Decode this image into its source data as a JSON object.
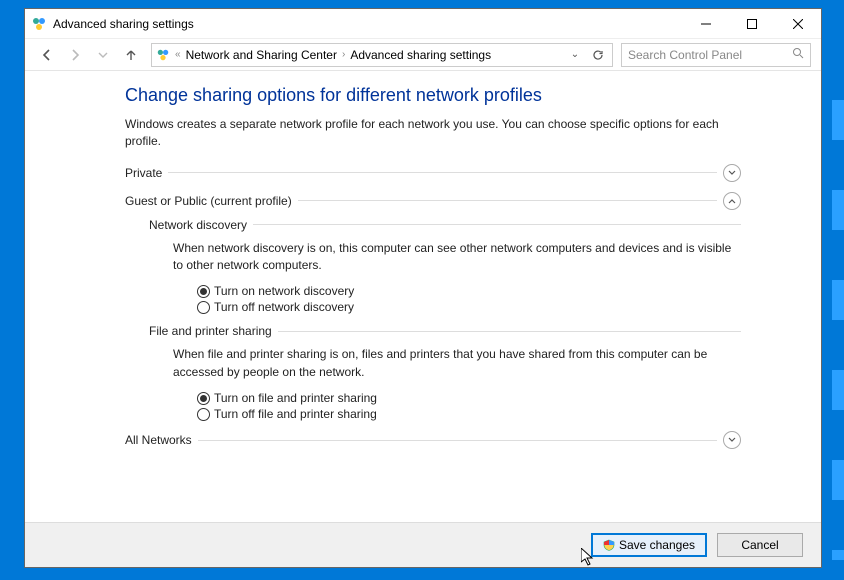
{
  "window": {
    "title": "Advanced sharing settings"
  },
  "breadcrumb": {
    "seg1": "Network and Sharing Center",
    "seg2": "Advanced sharing settings"
  },
  "search": {
    "placeholder": "Search Control Panel"
  },
  "page": {
    "title": "Change sharing options for different network profiles",
    "desc": "Windows creates a separate network profile for each network you use. You can choose specific options for each profile."
  },
  "sections": {
    "private": {
      "label": "Private"
    },
    "guest": {
      "label": "Guest or Public (current profile)",
      "network_discovery": {
        "heading": "Network discovery",
        "desc": "When network discovery is on, this computer can see other network computers and devices and is visible to other network computers.",
        "opt_on": "Turn on network discovery",
        "opt_off": "Turn off network discovery"
      },
      "file_printer": {
        "heading": "File and printer sharing",
        "desc": "When file and printer sharing is on, files and printers that you have shared from this computer can be accessed by people on the network.",
        "opt_on": "Turn on file and printer sharing",
        "opt_off": "Turn off file and printer sharing"
      }
    },
    "all": {
      "label": "All Networks"
    }
  },
  "footer": {
    "save": "Save changes",
    "cancel": "Cancel"
  }
}
